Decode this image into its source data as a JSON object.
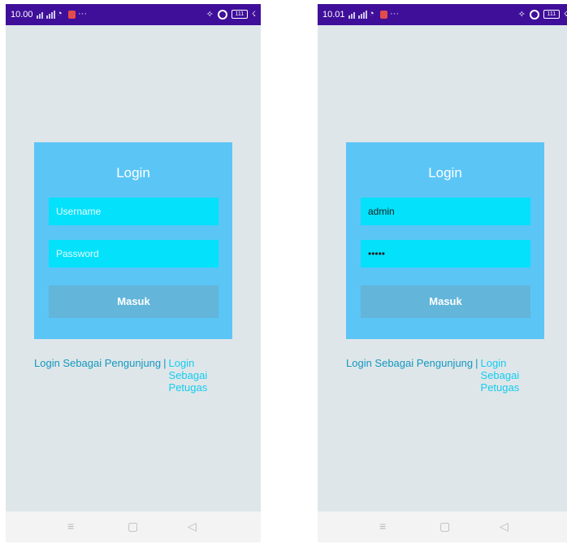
{
  "screens": [
    {
      "status": {
        "time": "10.00"
      },
      "login": {
        "title": "Login",
        "username": {
          "placeholder": "Username",
          "value": ""
        },
        "password": {
          "placeholder": "Password",
          "value": ""
        },
        "submit_label": "Masuk"
      },
      "links": {
        "visitor": "Login Sebagai Pengunjung",
        "separator": "|",
        "staff": "Login Sebagai Petugas"
      }
    },
    {
      "status": {
        "time": "10.01"
      },
      "login": {
        "title": "Login",
        "username": {
          "placeholder": "Username",
          "value": "admin"
        },
        "password": {
          "placeholder": "Password",
          "value": "•••••"
        },
        "submit_label": "Masuk"
      },
      "links": {
        "visitor": "Login Sebagai Pengunjung",
        "separator": "|",
        "staff": "Login Sebagai Petugas"
      }
    }
  ],
  "icons": {
    "status": [
      "signal-icon",
      "wifi-icon",
      "notification-icon",
      "more-icon",
      "vibrate-icon",
      "alarm-icon",
      "battery-icon",
      "charging-icon"
    ],
    "nav": [
      "menu-icon",
      "home-icon",
      "back-icon"
    ]
  },
  "colors": {
    "status_bar": "#3f0f9a",
    "screen_bg": "#dfe6e9",
    "card": "#5bc5f6",
    "input": "#03e1fb",
    "button": "#63b5da",
    "link_primary": "#1398c0",
    "link_accent": "#14ccf0"
  }
}
